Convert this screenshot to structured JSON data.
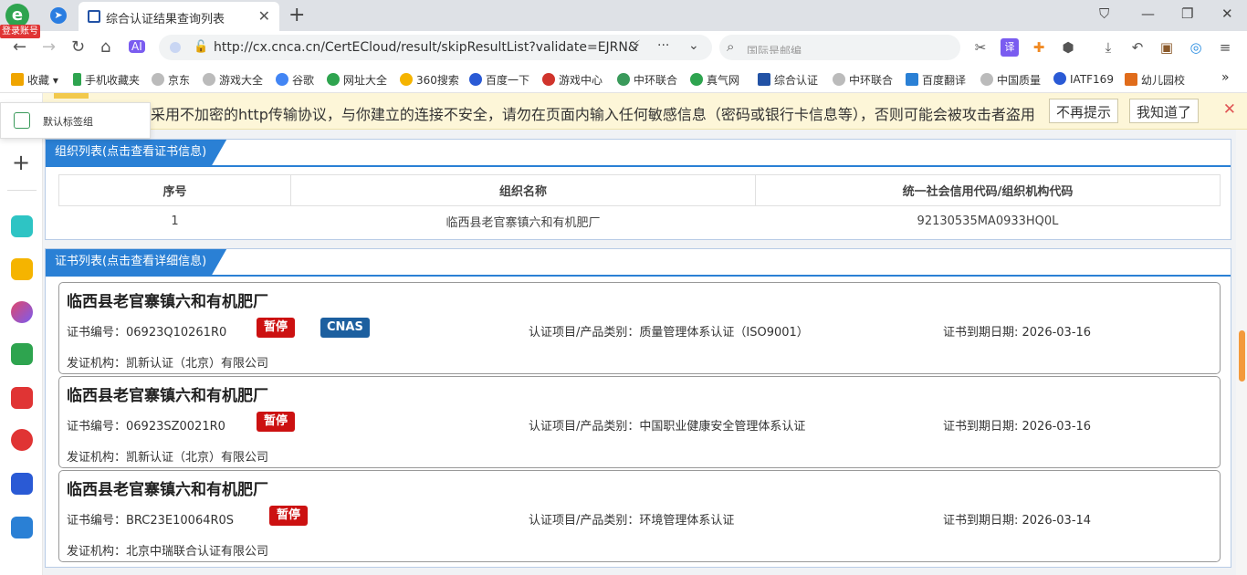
{
  "browser": {
    "login_badge": "登录账号",
    "tab_title": "综合认证结果查询列表",
    "url": "http://cx.cnca.cn/CertECloud/result/skipResultList?validate=EJRN&",
    "search_placeholder": "国际是邮编"
  },
  "bookmarks": [
    "收藏",
    "手机收藏夹",
    "京东",
    "游戏大全",
    "谷歌",
    "网址大全",
    "360搜索",
    "百度一下",
    "游戏中心",
    "中环联合",
    "真气网",
    "综合认证",
    "中环联合",
    "百度翻译",
    "中国质量",
    "IATF169",
    "幼儿园校"
  ],
  "sidebar": {
    "popup_label": "默认标签组"
  },
  "warning": {
    "text": "采用不加密的http传输协议，与你建立的连接不安全，请勿在页面内输入任何敏感信息（密码或银行卡信息等），否则可能会被攻击者盗用",
    "dismiss": "不再提示",
    "ok": "我知道了"
  },
  "org_panel": {
    "title": "组织列表(点击查看证书信息)",
    "headers": [
      "序号",
      "组织名称",
      "统一社会信用代码/组织机构代码"
    ],
    "rows": [
      [
        "1",
        "临西县老官寨镇六和有机肥厂",
        "92130535MA0933HQ0L"
      ]
    ]
  },
  "cert_panel": {
    "title": "证书列表(点击查看详细信息)",
    "cards": [
      {
        "org": "临西县老官寨镇六和有机肥厂",
        "cert_no": "证书编号：06923Q10261R0",
        "status": "暂停",
        "cnas": "CNAS",
        "item": "认证项目/产品类别：质量管理体系认证（ISO9001）",
        "expiry": "证书到期日期: 2026-03-16",
        "issuer": "发证机构：凯新认证（北京）有限公司"
      },
      {
        "org": "临西县老官寨镇六和有机肥厂",
        "cert_no": "证书编号：06923SZ0021R0",
        "status": "暂停",
        "item": "认证项目/产品类别：中国职业健康安全管理体系认证",
        "expiry": "证书到期日期: 2026-03-16",
        "issuer": "发证机构：凯新认证（北京）有限公司"
      },
      {
        "org": "临西县老官寨镇六和有机肥厂",
        "cert_no": "证书编号：BRC23E10064R0S",
        "status": "暂停",
        "item": "认证项目/产品类别：环境管理体系认证",
        "expiry": "证书到期日期: 2026-03-14",
        "issuer": "发证机构：北京中瑞联合认证有限公司"
      }
    ]
  },
  "colors": {
    "panel_header": "#2a80d5",
    "suspended": "#cc1111",
    "cnas": "#1c5f9f",
    "warning_bg": "#fdf6d8"
  }
}
